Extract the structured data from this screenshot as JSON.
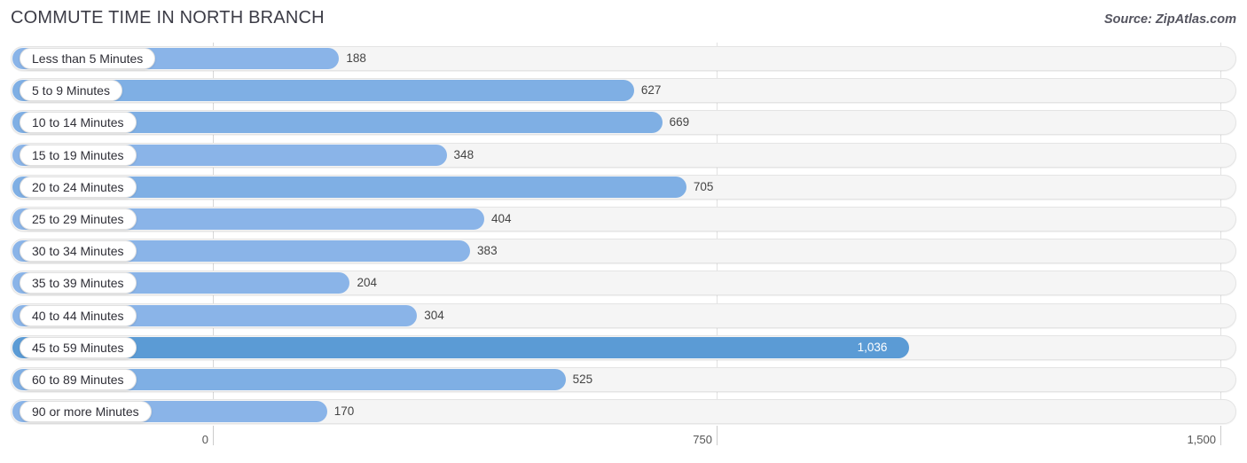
{
  "header": {
    "title": "COMMUTE TIME IN NORTH BRANCH",
    "source": "Source: ZipAtlas.com"
  },
  "chart_data": {
    "type": "bar",
    "orientation": "horizontal",
    "title": "COMMUTE TIME IN NORTH BRANCH",
    "xlabel": "",
    "ylabel": "",
    "xlim": [
      0,
      1500
    ],
    "grid": true,
    "legend": null,
    "tick_labels": [
      "0",
      "750",
      "1,500"
    ],
    "tick_values": [
      0,
      750,
      1500
    ],
    "categories": [
      "Less than 5 Minutes",
      "5 to 9 Minutes",
      "10 to 14 Minutes",
      "15 to 19 Minutes",
      "20 to 24 Minutes",
      "25 to 29 Minutes",
      "30 to 34 Minutes",
      "35 to 39 Minutes",
      "40 to 44 Minutes",
      "45 to 59 Minutes",
      "60 to 89 Minutes",
      "90 or more Minutes"
    ],
    "values": [
      188,
      627,
      669,
      348,
      705,
      404,
      383,
      204,
      304,
      1036,
      525,
      170
    ],
    "value_labels": [
      "188",
      "627",
      "669",
      "348",
      "705",
      "404",
      "383",
      "204",
      "304",
      "1,036",
      "525",
      "170"
    ],
    "colors": {
      "bar_light": "#9cc0ea",
      "bar_mid": "#7fafe4",
      "bar_dark": "#5b9bd5",
      "track": "#f5f5f5",
      "grid": "#e2e2e2",
      "text": "#444444"
    }
  },
  "axis": {
    "ticks": [
      {
        "label": "0",
        "value": 0
      },
      {
        "label": "750",
        "value": 750
      },
      {
        "label": "1,500",
        "value": 1500
      }
    ]
  }
}
